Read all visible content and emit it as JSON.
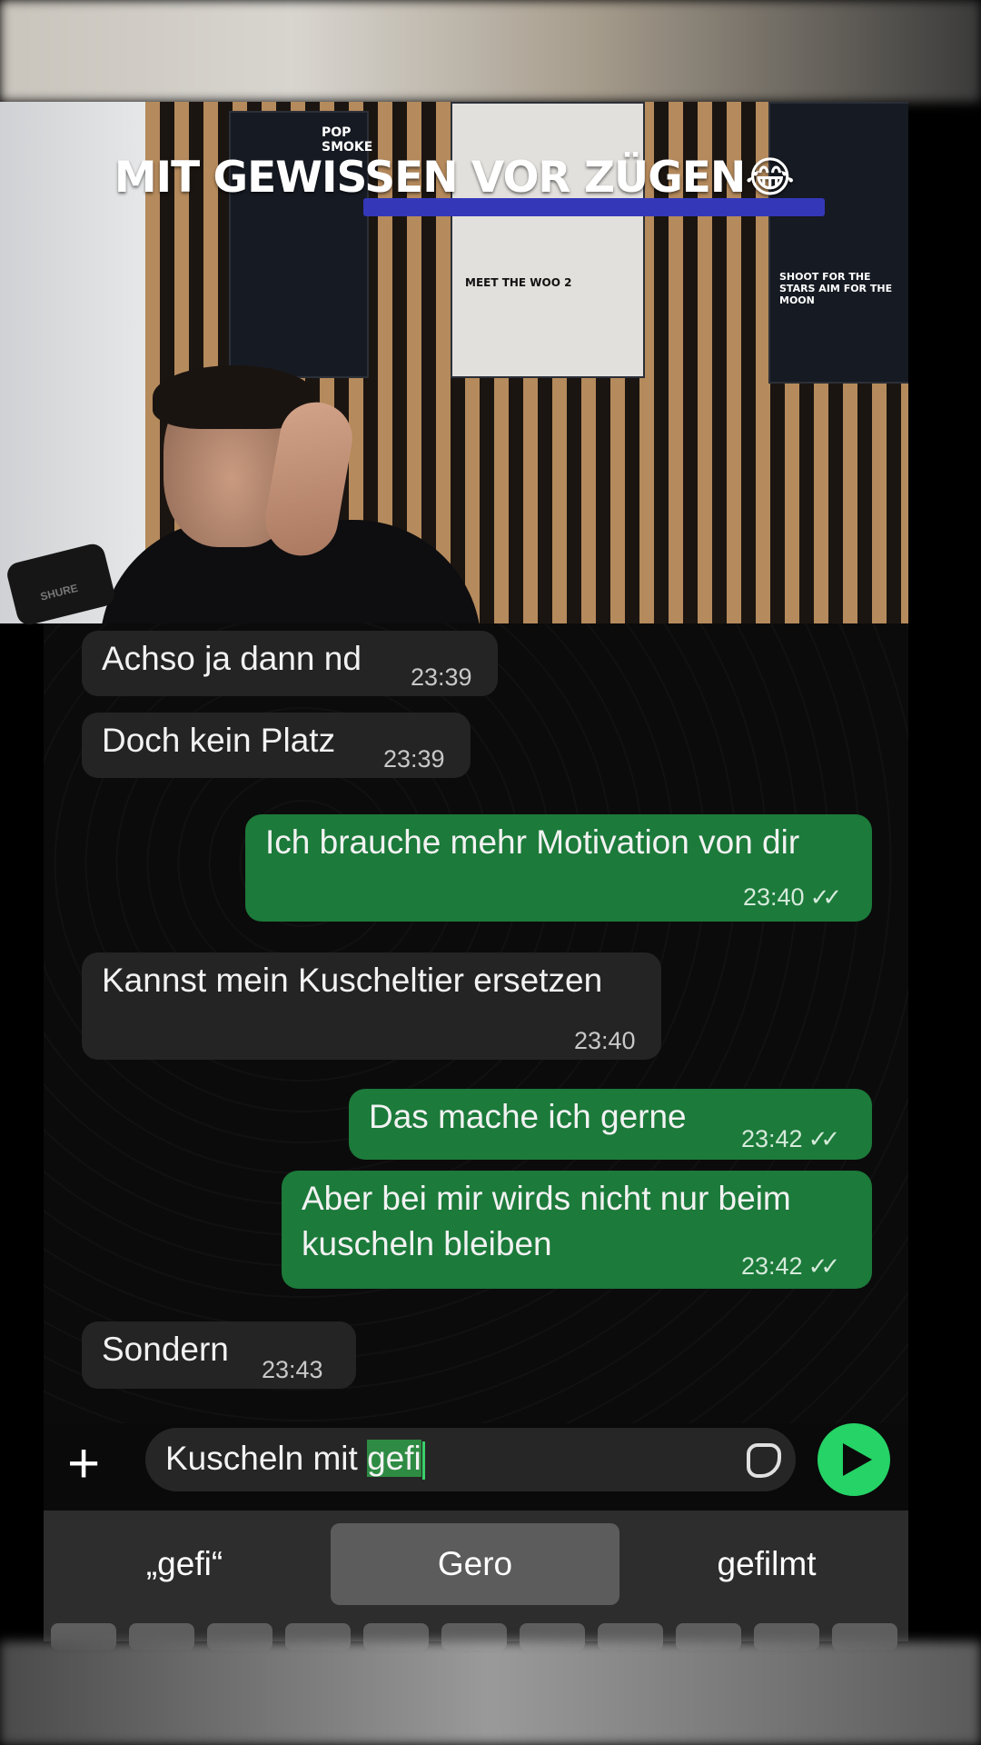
{
  "caption": {
    "text": "MIT GEWISSEN VOR ZÜGEN😂"
  },
  "posters": [
    {
      "title": "POP SMOKE"
    },
    {
      "title": "MEET THE WOO 2"
    },
    {
      "title": "SHOOT FOR THE STARS AIM FOR THE MOON"
    }
  ],
  "microphone": {
    "brand": "SHURE"
  },
  "messages": [
    {
      "direction": "in",
      "text": "Achso ja dann nd",
      "time": "23:39"
    },
    {
      "direction": "in",
      "text": "Doch kein Platz",
      "time": "23:39"
    },
    {
      "direction": "out",
      "text": "Ich brauche mehr Motivation von dir",
      "time": "23:40",
      "status": "read"
    },
    {
      "direction": "in",
      "text": "Kannst mein Kuscheltier ersetzen",
      "time": "23:40"
    },
    {
      "direction": "out",
      "text": "Das mache ich gerne",
      "time": "23:42",
      "status": "read"
    },
    {
      "direction": "out",
      "text_line1": "Aber bei mir wirds nicht nur beim",
      "text_line2": "kuscheln bleiben",
      "time": "23:42",
      "status": "read"
    },
    {
      "direction": "in",
      "text": "Sondern",
      "time": "23:43"
    }
  ],
  "composer": {
    "text_before": "Kuscheln mit ",
    "text_highlight": "gefi",
    "plus_icon": "plus-icon",
    "sticker_icon": "sticker-icon",
    "send_icon": "send-icon"
  },
  "keyboard": {
    "suggestions": [
      "„gefi“",
      "Gero",
      "gefilmt"
    ]
  },
  "colors": {
    "outgoing_bubble": "#1c7a3a",
    "incoming_bubble": "#242424",
    "send_button": "#25d366",
    "caption_underline": "#3438b8"
  }
}
